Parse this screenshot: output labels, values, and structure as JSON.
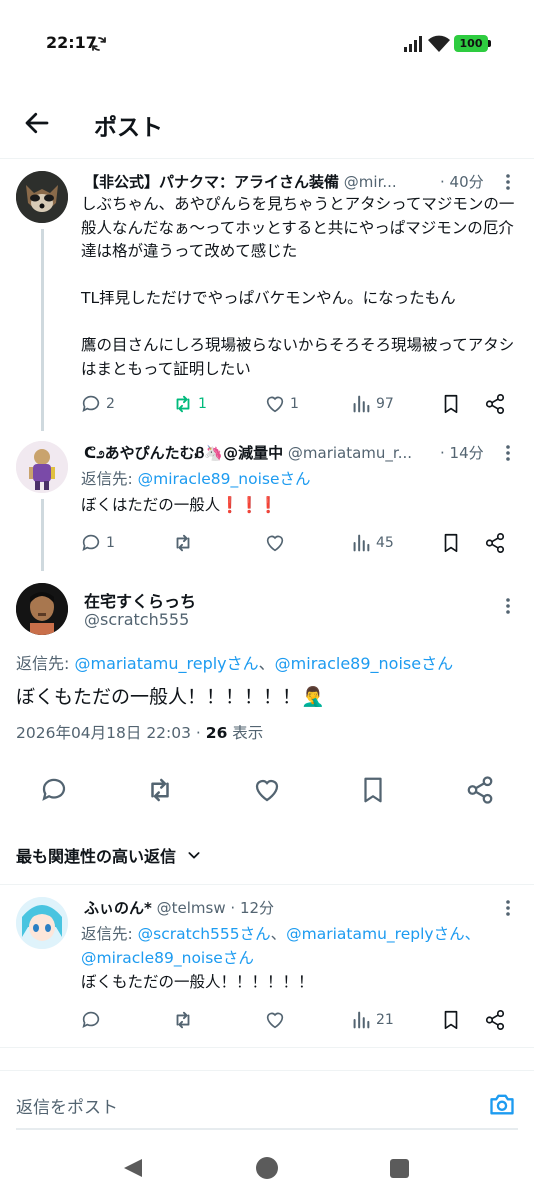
{
  "status_bar": {
    "time": "22:17",
    "battery": "100"
  },
  "header": {
    "title": "ポスト"
  },
  "colors": {
    "accent": "#1d9bf0",
    "retweet": "#00ba7c",
    "secondary": "#536471"
  },
  "thread": [
    {
      "display_name": "【非公式】パナクマ：アライさん装備",
      "handle": "@mir...",
      "time": "· 40分",
      "text": "しぶちゃん、あやぴんらを見ちゃうとアタシってマジモンの一般人なんだなぁ〜ってホッとすると共にやっぱマジモンの厄介達は格が違うって改めて感じた\n\nTL拝見しただけでやっぱバケモンやん。になったもん\n\n鷹の目さんにしろ現場被らないからそろそろ現場被ってアタシはまともって証明したい",
      "actions": {
        "replies": "2",
        "retweets": "1",
        "likes": "1",
        "views": "97"
      }
    },
    {
      "display_name": "ᕦ೨あやぴんたむᏰ🦄@減量中",
      "handle": "@mariatamu_r...",
      "time": "· 14分",
      "reply_prefix": "返信先: ",
      "reply_link": "@miracle89_noiseさん",
      "text": "ぼくはただの一般人❗❗❗",
      "actions": {
        "replies": "1",
        "retweets": "",
        "likes": "",
        "views": "45"
      }
    }
  ],
  "main_post": {
    "display_name": "在宅すくらっち",
    "handle": "@scratch555",
    "reply_prefix": "返信先: ",
    "reply_link_1": "@mariatamu_replyさん",
    "reply_sep": "、",
    "reply_link_2": "@miracle89_noiseさん",
    "text": "ぼくもただの一般人！！！！！！🤦‍♂️",
    "date": "2026年04月18日 22:03 · ",
    "views": "26",
    "views_label": " 表示"
  },
  "sort_label": "最も関連性の高い返信",
  "reply": {
    "display_name": "ふぃのん*",
    "handle": "@telmsw",
    "time": "· 12分",
    "reply_prefix": "返信先: ",
    "reply_link_1": "@scratch555さん",
    "reply_sep": "、",
    "reply_link_2": "@mariatamu_replyさん、",
    "reply_link_3": "@miracle89_noiseさん",
    "text": "ぼくもただの一般人！！！！！！",
    "actions": {
      "replies": "",
      "retweets": "",
      "likes": "",
      "views": "21"
    }
  },
  "compose": {
    "placeholder": "返信をポスト"
  }
}
